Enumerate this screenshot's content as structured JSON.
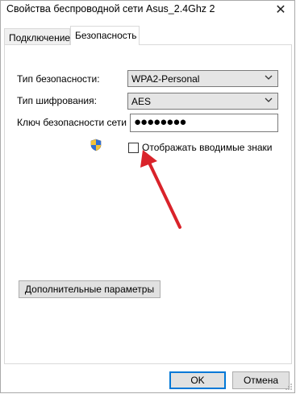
{
  "window": {
    "title": "Свойства беспроводной сети Asus_2.4Ghz 2",
    "close_glyph": "✕"
  },
  "tabs": [
    {
      "label": "Подключение",
      "active": false
    },
    {
      "label": "Безопасность",
      "active": true
    }
  ],
  "security": {
    "type_label": "Тип безопасности:",
    "type_value": "WPA2-Personal",
    "encryption_label": "Тип шифрования:",
    "encryption_value": "AES",
    "key_label": "Ключ безопасности сети",
    "key_value": "●●●●●●●●",
    "show_chars_label": "Отображать вводимые знаки",
    "show_chars_checked": false,
    "shield_icon": "uac-shield-icon"
  },
  "advanced_button_label": "Дополнительные параметры",
  "footer": {
    "ok_label": "OK",
    "cancel_label": "Отмена"
  },
  "colors": {
    "annotation_arrow": "#d9232a",
    "ok_border": "#0078d7"
  }
}
